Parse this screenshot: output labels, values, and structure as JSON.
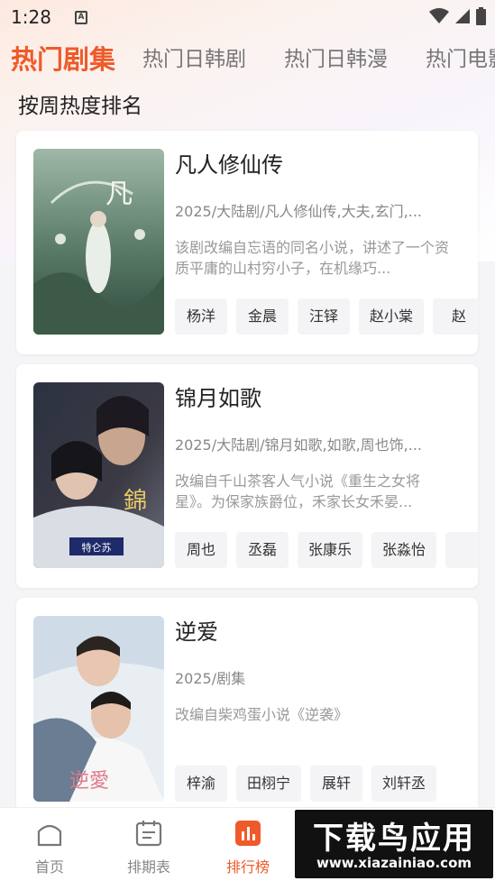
{
  "status_bar": {
    "time": "1:28",
    "notification_letter": "A"
  },
  "tabs": [
    {
      "label": "热门剧集",
      "active": true
    },
    {
      "label": "热门日韩剧",
      "active": false
    },
    {
      "label": "热门日韩漫",
      "active": false
    },
    {
      "label": "热门电影",
      "active": false
    }
  ],
  "section_title": "按周热度排名",
  "cards": [
    {
      "title": "凡人修仙传",
      "meta": "2025/大陆剧/凡人修仙传,大夫,玄门,...",
      "description": "该剧改编自忘语的同名小说，讲述了一个资质平庸的山村穷小子，在机缘巧...",
      "cast": [
        "杨洋",
        "金晨",
        "汪铎",
        "赵小棠",
        "赵"
      ],
      "poster_icon": "fantasy-drama-poster"
    },
    {
      "title": "锦月如歌",
      "meta": "2025/大陆剧/锦月如歌,如歌,周也饰,...",
      "description": "改编自千山茶客人气小说《重生之女将星》。为保家族爵位，禾家长女禾晏...",
      "cast": [
        "周也",
        "丞磊",
        "张康乐",
        "张淼怡",
        ""
      ],
      "poster_icon": "historical-drama-poster",
      "poster_badge": "特仑苏"
    },
    {
      "title": "逆爱",
      "meta": "2025/剧集",
      "description": "改编自柴鸡蛋小说《逆袭》",
      "cast": [
        "梓渝",
        "田栩宁",
        "展轩",
        "刘轩丞"
      ],
      "poster_icon": "romance-drama-poster"
    }
  ],
  "bottom_nav": [
    {
      "label": "首页",
      "icon": "home-icon",
      "active": false
    },
    {
      "label": "排期表",
      "icon": "calendar-icon",
      "active": false
    },
    {
      "label": "排行榜",
      "icon": "ranking-icon",
      "active": true
    }
  ],
  "watermark": {
    "main": "下载鸟应用",
    "sub": "www.xiazainiao.com"
  },
  "colors": {
    "accent": "#ef5a2a",
    "text": "#222222",
    "muted": "#888888"
  }
}
